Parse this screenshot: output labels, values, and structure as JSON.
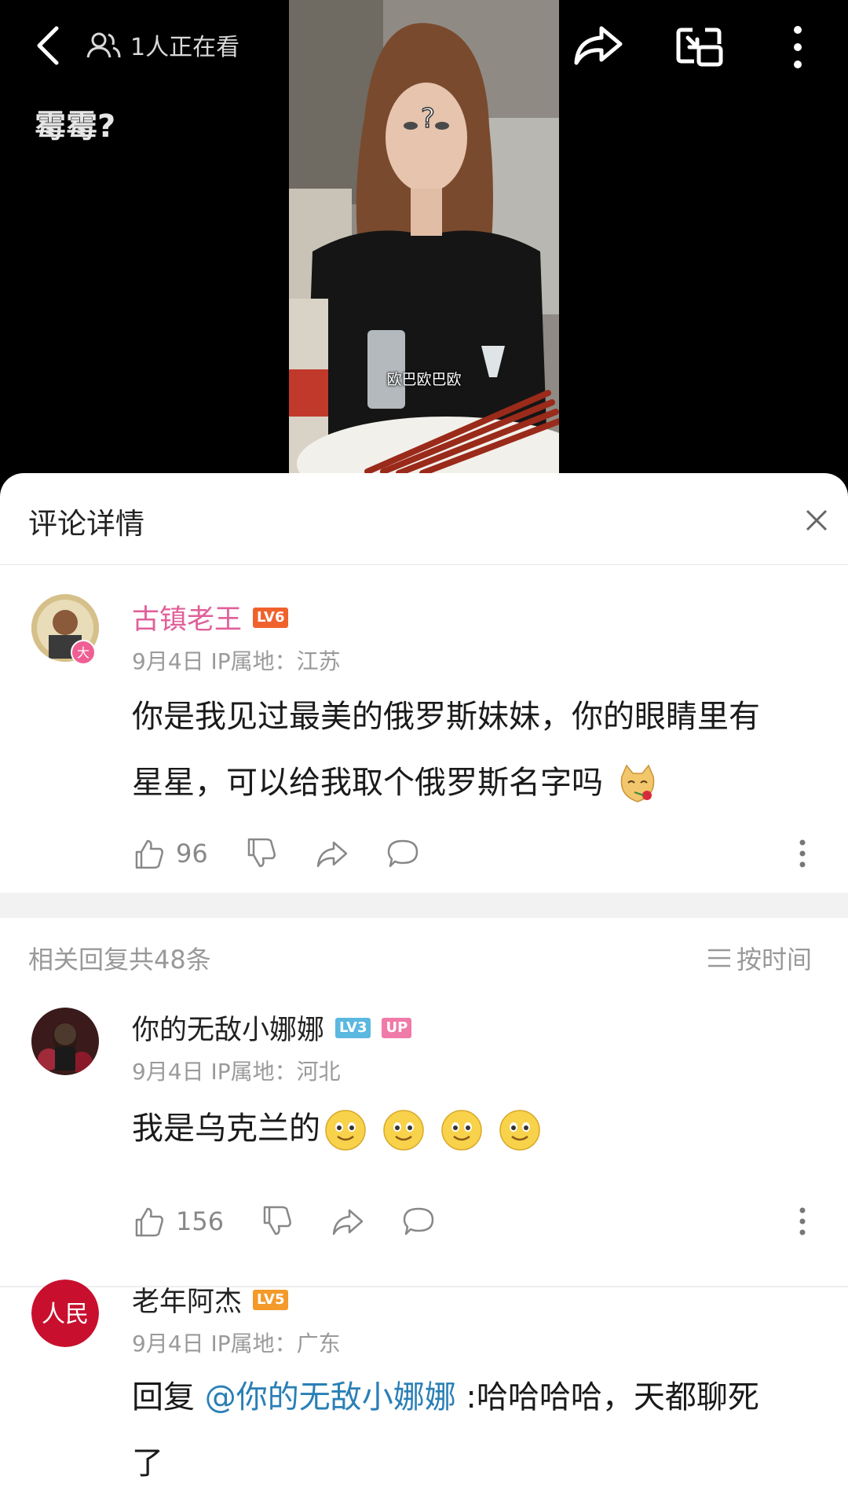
{
  "top_bar": {
    "viewer_text": "1人正在看",
    "video_title": "霉霉?",
    "video_caption": "欧巴欧巴欧"
  },
  "sheet": {
    "title": "评论详情"
  },
  "main_comment": {
    "username": "古镇老王",
    "level": "LV6",
    "badge": "大",
    "meta": "9月4日 IP属地：江苏",
    "text_line1": "你是我见过最美的俄罗斯妹妹，你的眼睛里有",
    "text_line2": "星星，可以给我取个俄罗斯名字吗",
    "likes": "96"
  },
  "replies_header": {
    "count_text": "相关回复共48条",
    "sort_label": "按时间"
  },
  "replies": [
    {
      "username": "你的无敌小娜娜",
      "level": "LV3",
      "up_badge": "UP",
      "meta": "9月4日 IP属地：河北",
      "text": "我是乌克兰的",
      "likes": "156"
    },
    {
      "username": "老年阿杰",
      "level": "LV5",
      "avatar_text": "人民",
      "meta": "9月4日 IP属地：广东",
      "reply_prefix": "回复 ",
      "mention": "@你的无敌小娜娜",
      "text_line1": " :哈哈哈哈，天都聊死",
      "text_line2": "了"
    }
  ],
  "colors": {
    "main_username": "#e0609a",
    "lv6": "#f0622d",
    "lv3": "#5bb8e0",
    "lv5": "#f39a2a",
    "up_badge": "#f07aa8",
    "mention": "#2a7fb6"
  }
}
